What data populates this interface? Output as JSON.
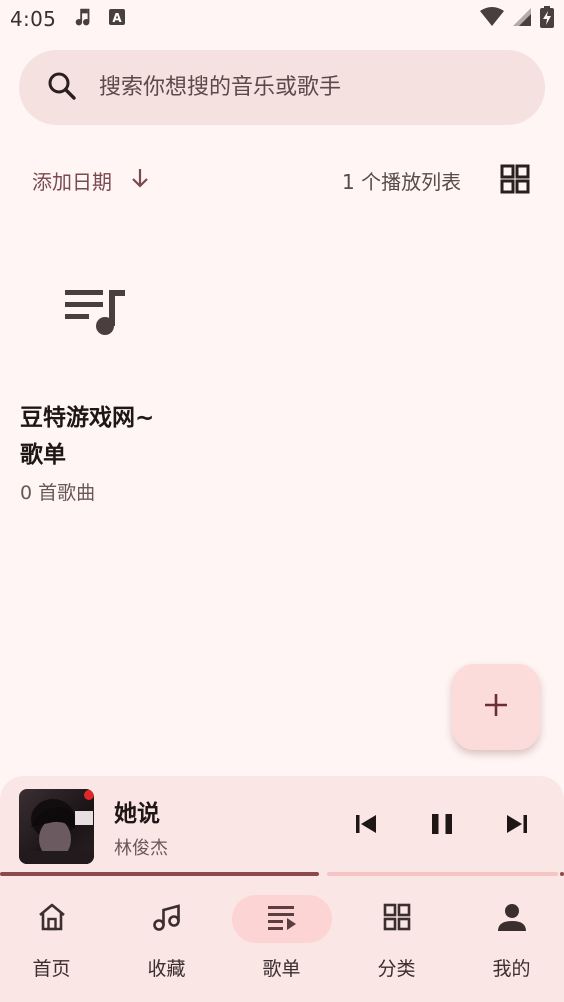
{
  "status_bar": {
    "time": "4:05"
  },
  "search": {
    "placeholder": "搜索你想搜的音乐或歌手",
    "value": ""
  },
  "sort": {
    "label": "添加日期",
    "count_label": "1 个播放列表"
  },
  "playlists": [
    {
      "title_line1": "豆特游戏网~",
      "title_line2": "歌单",
      "songs": "0 首歌曲"
    }
  ],
  "now_playing": {
    "title": "她说",
    "artist": "林俊杰",
    "progress": 0.565
  },
  "nav": {
    "items": [
      {
        "label": "首页",
        "icon": "home-icon"
      },
      {
        "label": "收藏",
        "icon": "music-notes-icon"
      },
      {
        "label": "歌单",
        "icon": "playlist-icon",
        "active": true
      },
      {
        "label": "分类",
        "icon": "grid-icon"
      },
      {
        "label": "我的",
        "icon": "person-icon"
      }
    ]
  },
  "colors": {
    "background": "#fff5f4",
    "search_bg": "#f5e1df",
    "accent": "#8c4a4c",
    "fab_bg": "#fcdcdb",
    "nav_active": "#fcd4d3"
  }
}
